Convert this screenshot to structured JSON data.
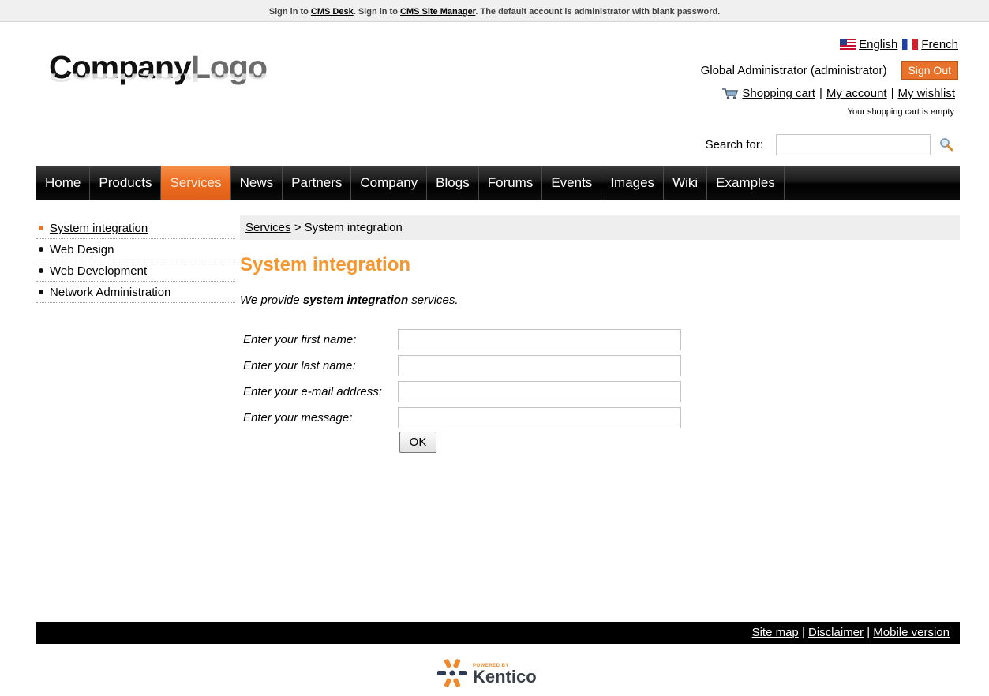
{
  "topbar": {
    "t1": "Sign in to ",
    "l1": "CMS Desk",
    "t2": ". Sign in to ",
    "l2": "CMS Site Manager",
    "t3": ". The default account is administrator with blank password."
  },
  "logo": {
    "part1": "Company",
    "part2": "Logo"
  },
  "header": {
    "lang_english": "English",
    "lang_french": "French",
    "user": "Global Administrator (administrator)",
    "signout": "Sign Out",
    "shopping_cart": "Shopping cart",
    "my_account": "My account",
    "my_wishlist": "My wishlist",
    "sep": "|",
    "cart_status": "Your shopping cart is empty",
    "search_label": "Search for:",
    "search_value": ""
  },
  "nav": {
    "items": [
      "Home",
      "Products",
      "Services",
      "News",
      "Partners",
      "Company",
      "Blogs",
      "Forums",
      "Events",
      "Images",
      "Wiki",
      "Examples"
    ],
    "active": "Services"
  },
  "leftmenu": {
    "items": [
      "System integration",
      "Web Design",
      "Web Development",
      "Network Administration"
    ],
    "active": "System integration"
  },
  "breadcrumb": {
    "link": "Services",
    "separator": ">",
    "current": "System integration"
  },
  "main": {
    "title": "System integration",
    "intro_pre": "We provide ",
    "intro_bold": "system integration",
    "intro_post": " services."
  },
  "form": {
    "first_name_label": "Enter your first name:",
    "last_name_label": "Enter your last name:",
    "email_label": "Enter your e-mail address:",
    "message_label": "Enter your message:",
    "first_name_value": "",
    "last_name_value": "",
    "email_value": "",
    "message_value": "",
    "ok_label": "OK"
  },
  "footer": {
    "site_map": "Site map",
    "disclaimer": "Disclaimer",
    "mobile": "Mobile version",
    "sep": "|",
    "powered_by": "POWERED BY",
    "brand": "Kentico"
  },
  "colors": {
    "accent_orange": "#e8722a",
    "title_orange": "#f5962e",
    "nav_bg": "#000000",
    "footer_bg": "#000000"
  }
}
